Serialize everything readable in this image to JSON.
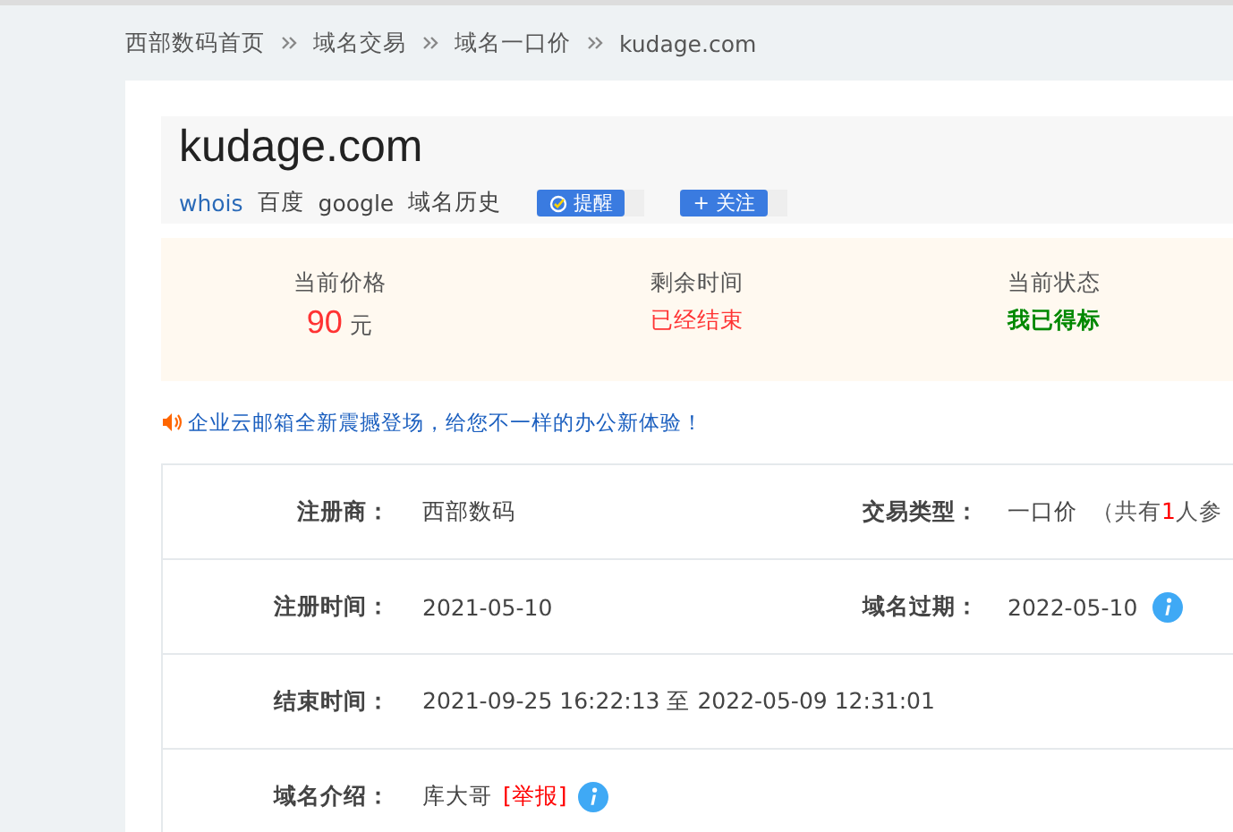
{
  "breadcrumb": [
    {
      "label": "西部数码首页"
    },
    {
      "label": "域名交易"
    },
    {
      "label": "域名一口价"
    },
    {
      "label": "kudage.com"
    }
  ],
  "domain": {
    "name": "kudage.com",
    "links": [
      {
        "label": "whois",
        "kind": "link"
      },
      {
        "label": "百度",
        "kind": "plain"
      },
      {
        "label": "google",
        "kind": "plain"
      },
      {
        "label": "域名历史",
        "kind": "plain"
      }
    ],
    "buttons": [
      {
        "label": "提醒",
        "kind": "remind"
      },
      {
        "label": "+ 关注",
        "kind": "follow"
      }
    ]
  },
  "stats": [
    {
      "label": "当前价格",
      "kind": "price",
      "value": "90",
      "unit": "元"
    },
    {
      "label": "剩余时间",
      "kind": "ended",
      "value": "已经结束"
    },
    {
      "label": "当前状态",
      "kind": "won",
      "value": "我已得标"
    }
  ],
  "notice": "企业云邮箱全新震撼登场，给您不一样的办公新体验！",
  "details": [
    {
      "cells": [
        {
          "label": "注册商：",
          "value": "西部数码"
        },
        {
          "label": "交易类型：",
          "value": "一口价",
          "note_before": "（共有",
          "count": "1",
          "note_after": "人参"
        }
      ]
    },
    {
      "cells": [
        {
          "label": "注册时间：",
          "value": "2021-05-10"
        },
        {
          "label": "域名过期：",
          "value": "2022-05-10",
          "info": true
        }
      ]
    },
    {
      "cells": [
        {
          "label": "结束时间：",
          "value": "2021-09-25 16:22:13 至 2022-05-09 12:31:01"
        }
      ]
    },
    {
      "cells": [
        {
          "label": "域名介绍：",
          "value": "库大哥",
          "report": "[举报]",
          "info": true
        }
      ]
    }
  ]
}
